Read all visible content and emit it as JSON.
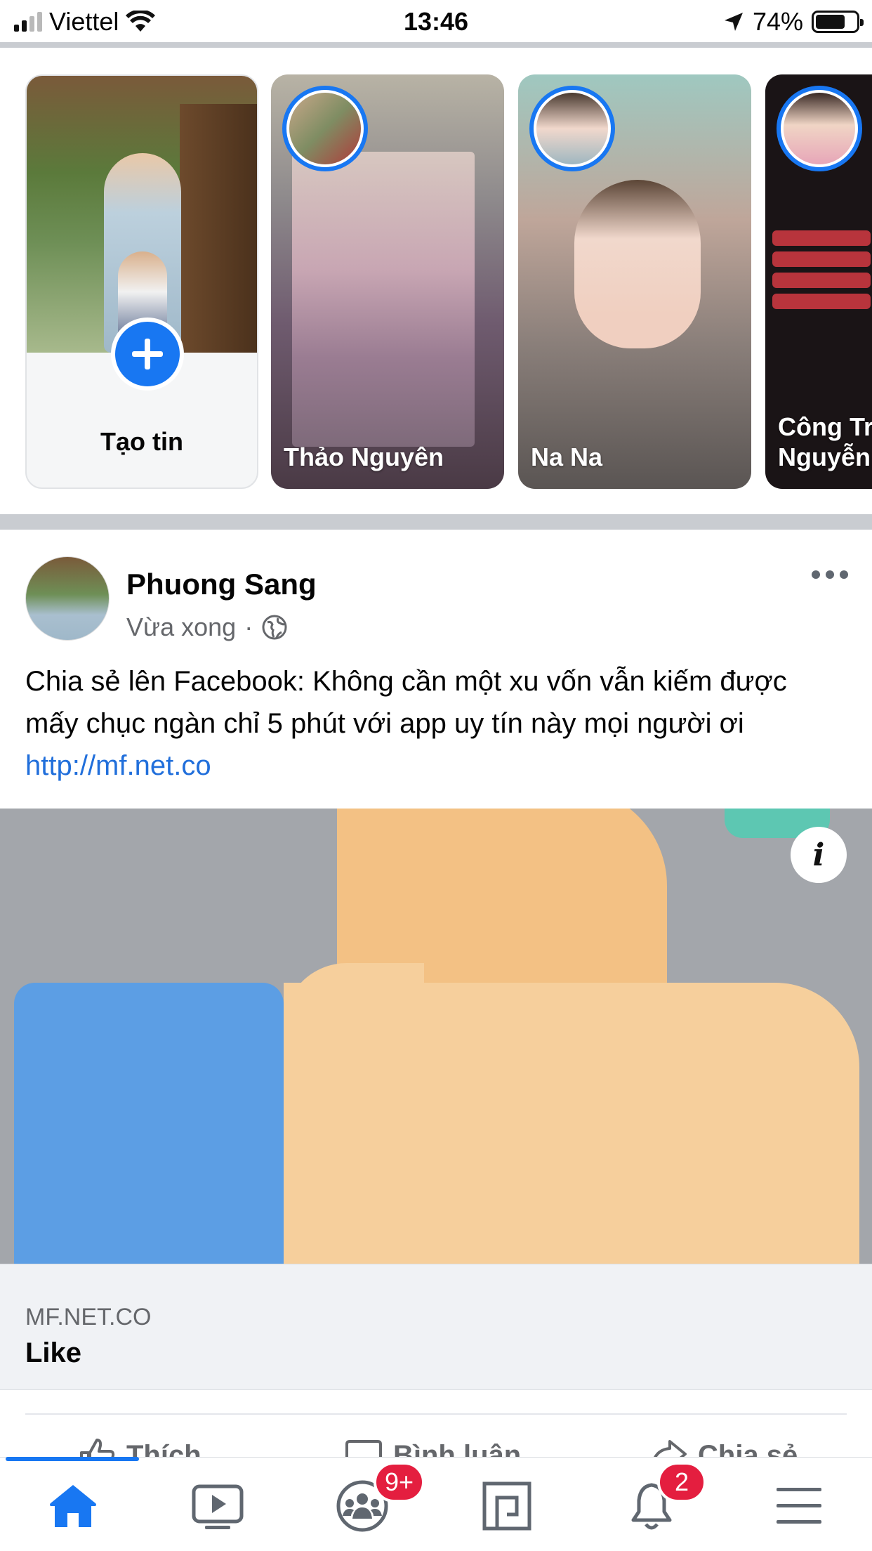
{
  "status_bar": {
    "carrier": "Viettel",
    "time": "13:46",
    "battery": "74%",
    "signal_bars_active": 2,
    "battery_level": 0.74
  },
  "stories": {
    "create_label": "Tạo tin",
    "items": [
      {
        "name": "Thảo Nguyên"
      },
      {
        "name": "Na Na"
      },
      {
        "name": "Công Tr\nNguyễn"
      }
    ]
  },
  "post": {
    "author": "Phuong Sang",
    "time": "Vừa xong",
    "separator": "·",
    "text": "Chia sẻ lên Facebook: Không cần một xu vốn vẫn kiếm được mấy chục ngàn chỉ 5 phút với app uy tín này mọi người ơi ",
    "link_text": "http://mf.net.co",
    "link_preview": {
      "domain": "MF.NET.CO",
      "title": "Like",
      "info_icon": "i"
    },
    "actions": {
      "like": "Thích",
      "comment": "Bình luận",
      "share": "Chia sẻ"
    }
  },
  "tab_bar": {
    "active": "home",
    "groups_badge": "9+",
    "notifications_badge": "2"
  },
  "colors": {
    "accent": "#1877f2",
    "badge": "#e41e3f",
    "link": "#216fdb"
  }
}
